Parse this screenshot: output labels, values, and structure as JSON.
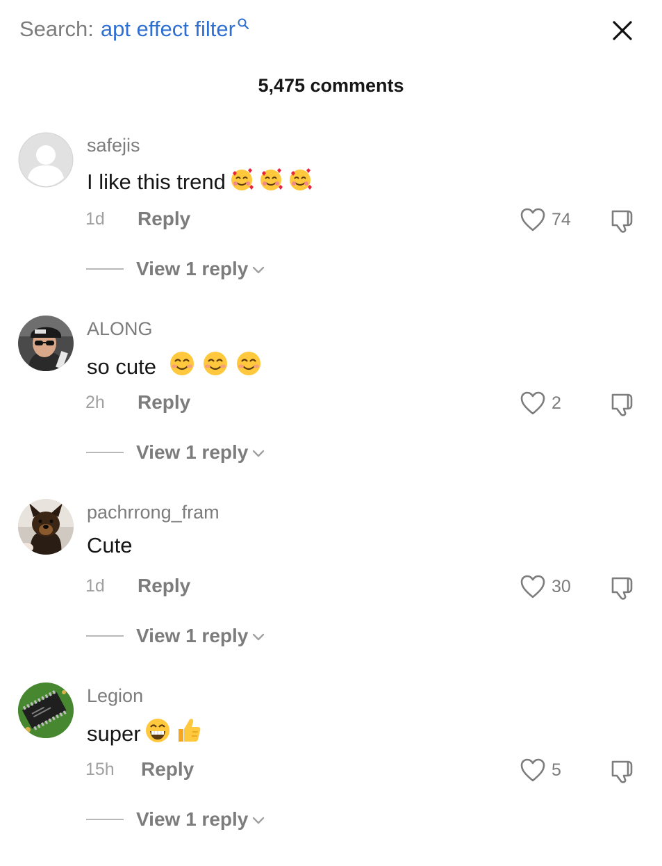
{
  "search": {
    "label": "Search:",
    "query": "apt effect filter"
  },
  "comment_count": "5,475 comments",
  "comments": [
    {
      "username": "safejis",
      "text": "I like this trend",
      "emojis": [
        "smiling-face-with-hearts",
        "smiling-face-with-hearts",
        "smiling-face-with-hearts"
      ],
      "time": "1d",
      "reply_label": "Reply",
      "likes": "74",
      "view_replies": "View 1 reply",
      "avatar": "default-avatar"
    },
    {
      "username": "ALONG",
      "text": "so cute ",
      "emojis": [
        "smiling-face-with-smiling-eyes",
        "smiling-face-with-smiling-eyes",
        "smiling-face-with-smiling-eyes"
      ],
      "time": "2h",
      "reply_label": "Reply",
      "likes": "2",
      "view_replies": "View 1 reply",
      "avatar": "man-with-cap-sunglasses-photo"
    },
    {
      "username": "pachrrong_fram",
      "text": "Cute",
      "emojis": [],
      "time": "1d",
      "reply_label": "Reply",
      "likes": "30",
      "view_replies": "View 1 reply",
      "avatar": "puppy-photo"
    },
    {
      "username": "Legion",
      "text": "super",
      "emojis": [
        "beaming-face",
        "thumbs-up"
      ],
      "time": "15h",
      "reply_label": "Reply",
      "likes": "5",
      "view_replies": "View 1 reply",
      "avatar": "circuit-board-photo"
    }
  ],
  "icons": {
    "search": "search-icon",
    "close": "close-icon",
    "like": "heart-icon",
    "dislike": "thumbs-down-icon",
    "chevron": "chevron-down-icon"
  },
  "colors": {
    "query": "#2f6fd1",
    "text": "#161616",
    "muted": "#7c7c7c"
  }
}
